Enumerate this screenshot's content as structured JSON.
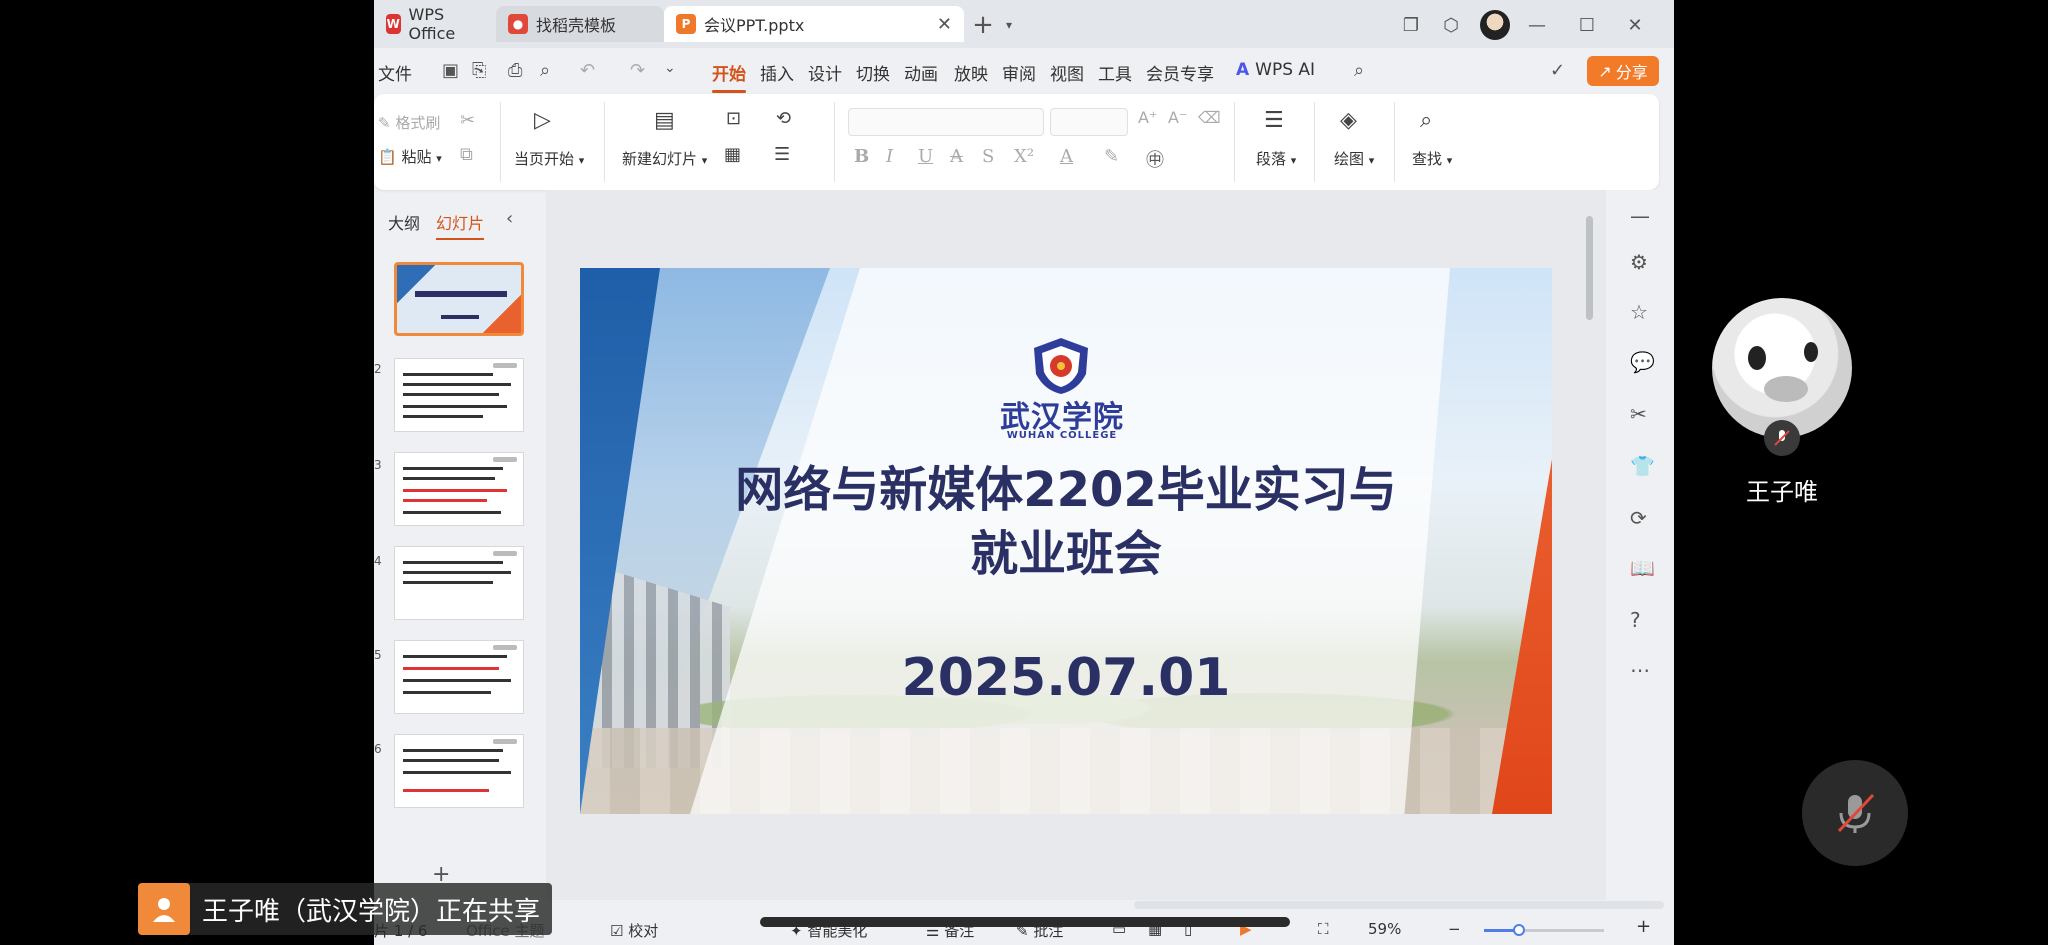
{
  "tabs": {
    "wps": "WPS Office",
    "template": "找稻壳模板",
    "doc": "会议PPT.pptx",
    "add": "+"
  },
  "menu": {
    "file": "文件",
    "items": [
      "开始",
      "插入",
      "设计",
      "切换",
      "动画",
      "放映",
      "审阅",
      "视图",
      "工具",
      "会员专享"
    ],
    "wps_ai": "WPS AI",
    "share": "分享"
  },
  "ribbon": {
    "format_painter": "格式刷",
    "paste": "粘贴",
    "start_from_current": "当页开始",
    "new_slide": "新建幻灯片",
    "paragraph": "段落",
    "draw": "绘图",
    "find": "查找"
  },
  "left_panel": {
    "outline_tab": "大纲",
    "slides_tab": "幻灯片",
    "slide_numbers": [
      "2",
      "3",
      "4",
      "5",
      "6"
    ]
  },
  "slide": {
    "college_cn": "武汉学院",
    "college_en": "WUHAN COLLEGE",
    "title_line1": "网络与新媒体2202毕业实习与",
    "title_line2": "就业班会",
    "date": "2025.07.01"
  },
  "statusbar": {
    "slide_counter": "片 1 / 6",
    "theme": "Office 主题",
    "proofread": "校对",
    "smart_beautify": "智能美化",
    "notes": "备注",
    "comments": "批注",
    "zoom": "59%",
    "zoom_level": 0.59
  },
  "overlay": {
    "share_banner": "王子唯（武汉学院）正在共享",
    "participant_name": "王子唯"
  },
  "colors": {
    "accent": "#d2541b",
    "share_button": "#f27b2a",
    "title_navy": "#2a3063",
    "college_blue": "#2f3d9a"
  }
}
